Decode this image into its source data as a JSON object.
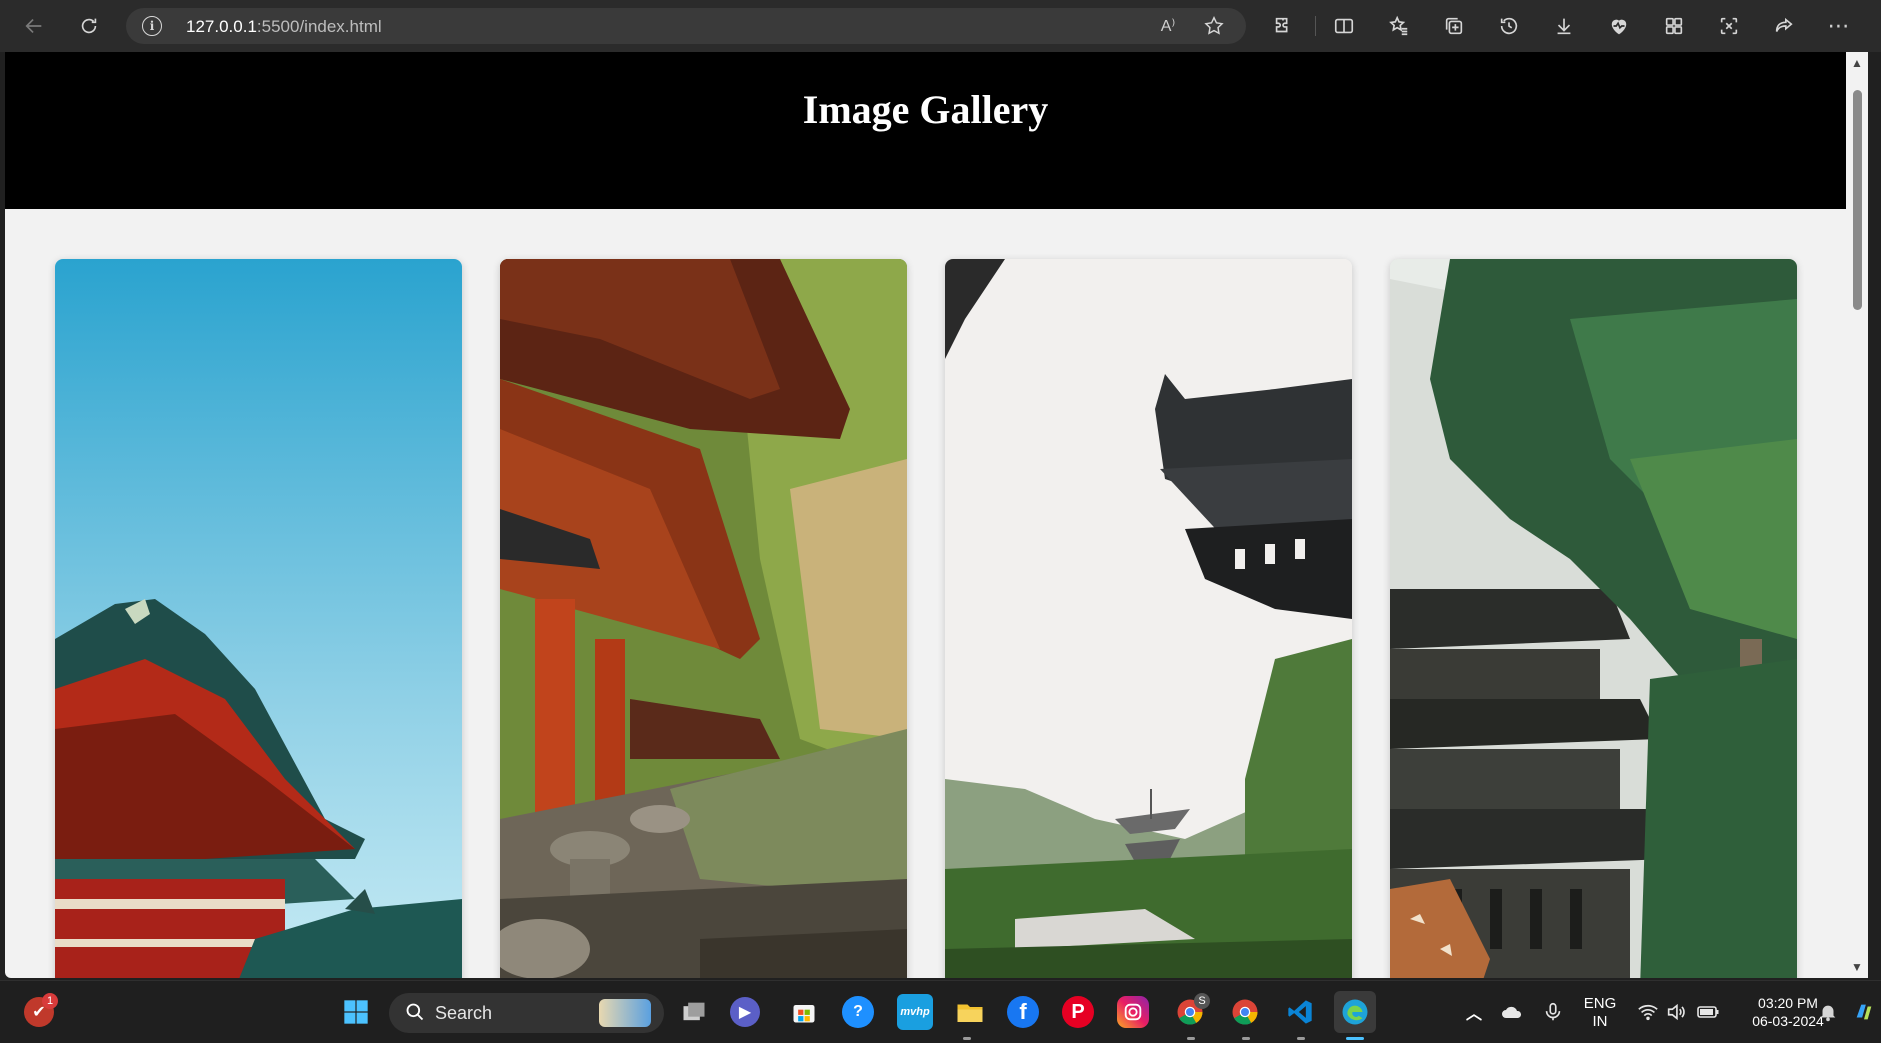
{
  "browser": {
    "url_host": "127.0.0.1",
    "url_path": ":5500/index.html",
    "read_aloud_label": "A⁾"
  },
  "page": {
    "title": "Image Gallery",
    "cards": [
      {
        "name": "pagoda-sky-image",
        "image": "red pagoda roof against blue sky"
      },
      {
        "name": "temple-lanterns-image",
        "image": "temple eaves with stone lanterns"
      },
      {
        "name": "temple-eave-mist-image",
        "image": "temple eave and misty pagoda"
      },
      {
        "name": "pagoda-trees-image",
        "image": "pagoda behind pine trees"
      }
    ]
  },
  "taskbar": {
    "search_label": "Search",
    "notification_badge": "1",
    "language": "ENG",
    "region": "IN",
    "time": "03:20 PM",
    "date": "06-03-2024",
    "chrome_badge": "S"
  },
  "colors": {
    "header_bg": "#000000",
    "page_bg": "#f2f2f2",
    "taskbar_bg": "#1f1f1f"
  }
}
